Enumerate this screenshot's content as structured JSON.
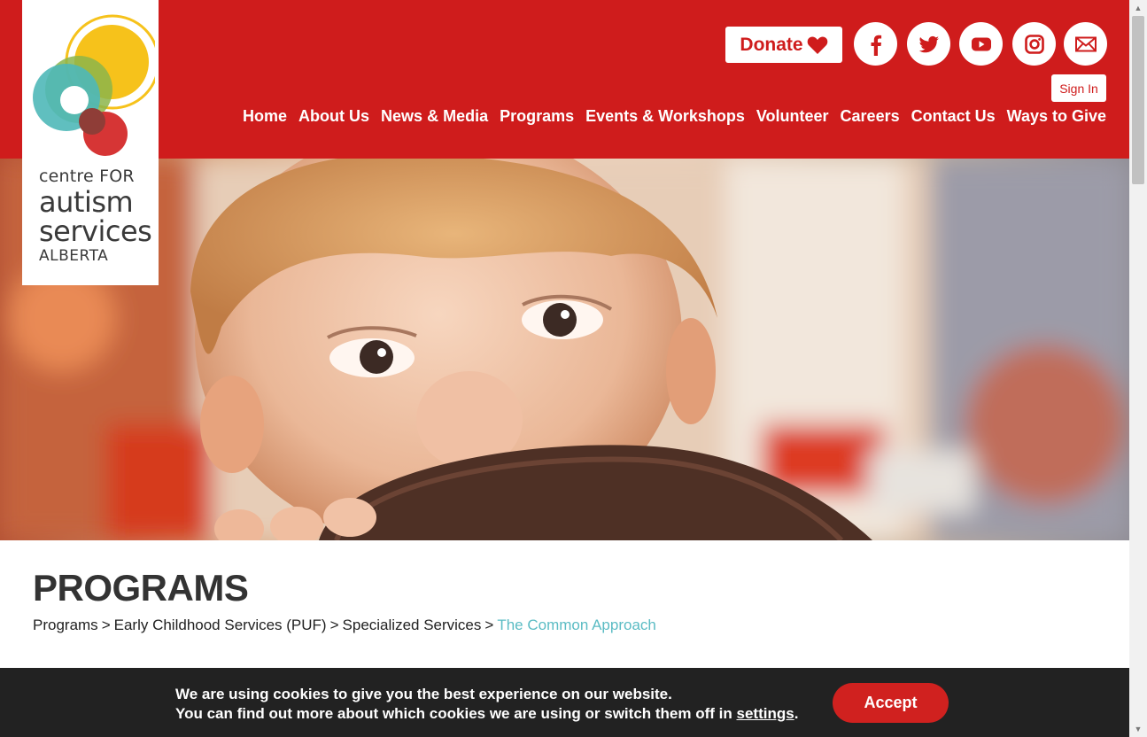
{
  "brand": {
    "line1": "centre FOR",
    "line2": "autism",
    "line3": "services",
    "line4": "ALBERTA",
    "colors": {
      "yellow": "#f6c21b",
      "green": "#8cb54a",
      "teal": "#4fb8b8",
      "red": "#d42a2a"
    }
  },
  "header": {
    "donate_label": "Donate",
    "signin_label": "Sign In",
    "social": [
      "facebook-icon",
      "twitter-icon",
      "youtube-icon",
      "instagram-icon",
      "mail-icon"
    ],
    "color": "#cf1c1c"
  },
  "nav": {
    "items": [
      {
        "label": "Home"
      },
      {
        "label": "About Us"
      },
      {
        "label": "News & Media"
      },
      {
        "label": "Programs"
      },
      {
        "label": "Events & Workshops"
      },
      {
        "label": "Volunteer"
      },
      {
        "label": "Careers"
      },
      {
        "label": "Contact Us"
      },
      {
        "label": "Ways to Give"
      }
    ]
  },
  "page": {
    "title": "PROGRAMS",
    "breadcrumb": [
      "Programs",
      "Early Childhood Services (PUF)",
      "Specialized Services",
      "The Common Approach"
    ],
    "breadcrumb_separator": ">"
  },
  "cookie": {
    "line1": "We are using cookies to give you the best experience on our website.",
    "line2_prefix": "You can find out more about which cookies we are using or switch them off in",
    "settings_link": "settings",
    "line2_suffix": ".",
    "accept_label": "Accept"
  }
}
